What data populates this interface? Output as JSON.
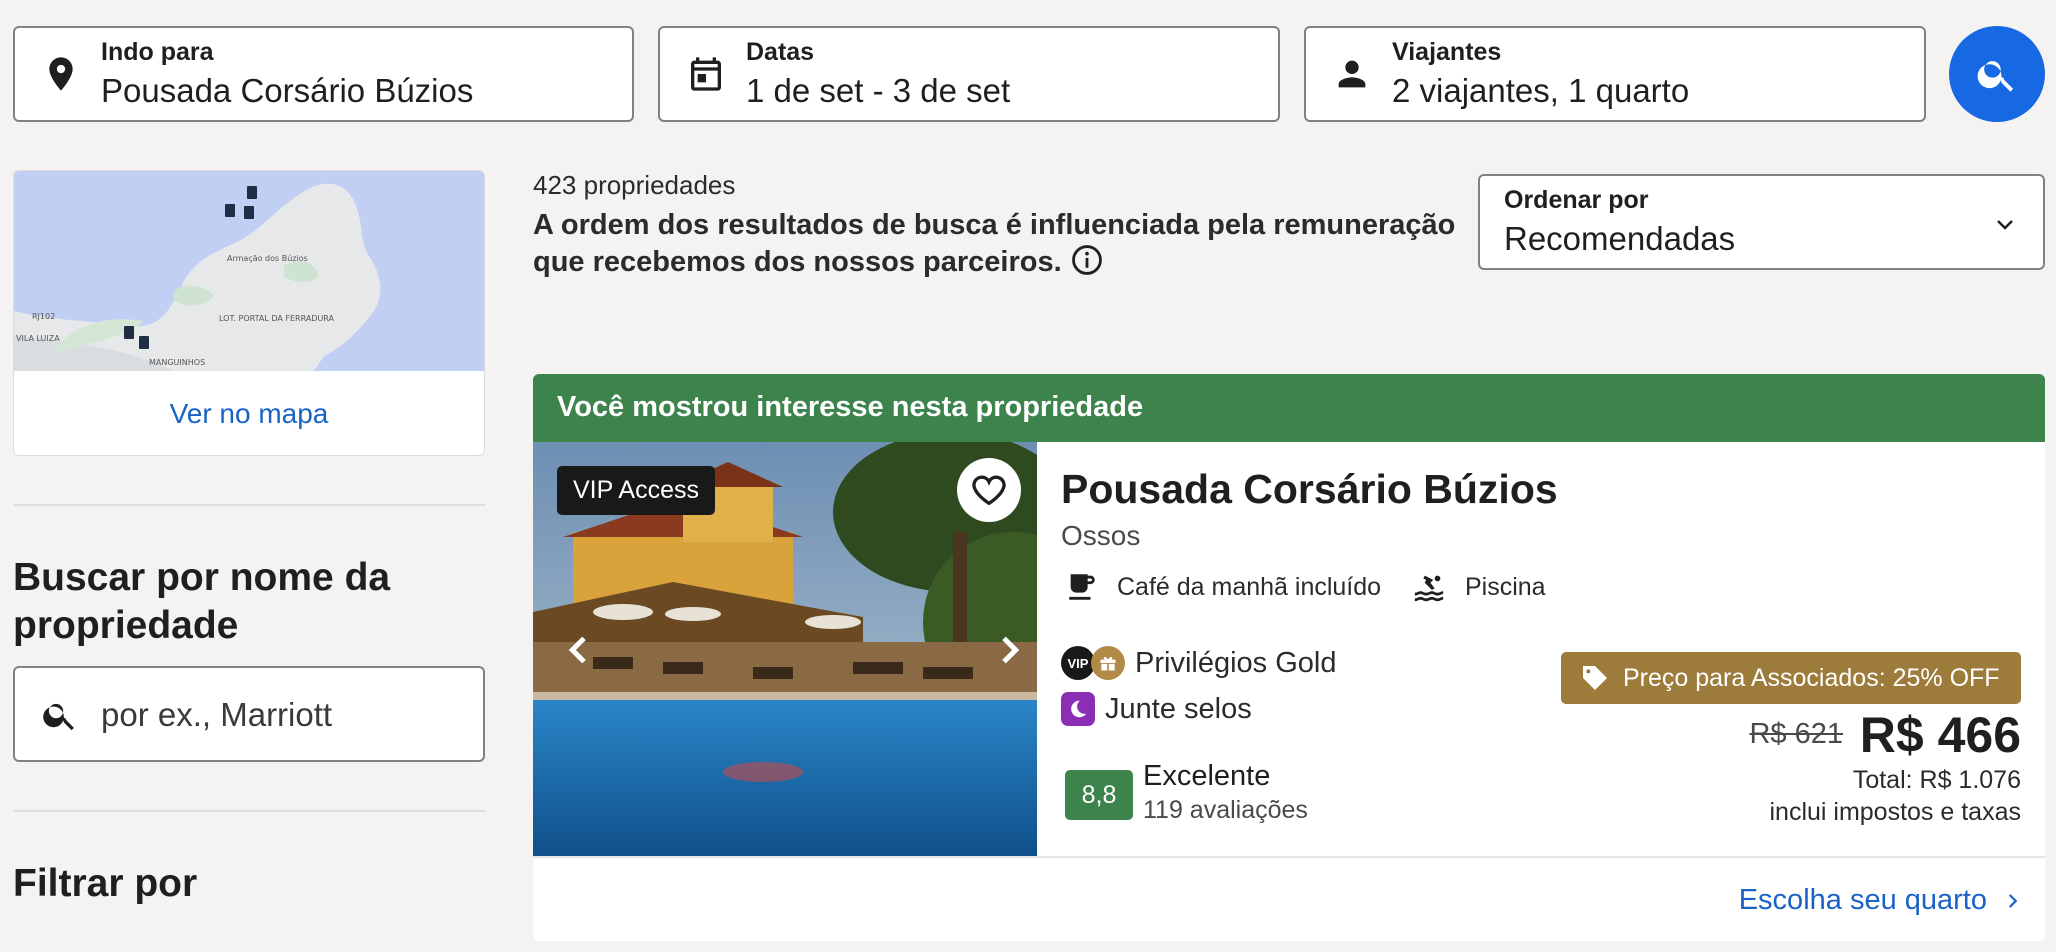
{
  "search": {
    "destination": {
      "label": "Indo para",
      "value": "Pousada Corsário Búzios",
      "icon": "location-pin-icon"
    },
    "dates": {
      "label": "Datas",
      "value": "1 de set - 3 de set",
      "icon": "calendar-icon"
    },
    "travelers": {
      "label": "Viajantes",
      "value": "2 viajantes, 1 quarto",
      "icon": "person-icon"
    },
    "button_icon": "search-icon"
  },
  "sidebar": {
    "map": {
      "labels": [
        "Armação dos Búzios",
        "LOT. PORTAL DA FERRADURA",
        "VILA LUIZA",
        "MANGUINHOS",
        "RJ102"
      ],
      "link": "Ver no mapa"
    },
    "name_search": {
      "title": "Buscar por nome da propriedade",
      "placeholder": "por ex., Marriott"
    },
    "filter_title": "Filtrar por"
  },
  "results": {
    "count": "423 propriedades",
    "disclaimer": "A ordem dos resultados de busca é influenciada pela remuneração que recebemos dos nossos parceiros.",
    "sort": {
      "label": "Ordenar por",
      "value": "Recomendadas"
    }
  },
  "property": {
    "banner": "Você mostrou interesse nesta propriedade",
    "badge": "VIP Access",
    "name": "Pousada Corsário Búzios",
    "area": "Ossos",
    "amenities": [
      "Café da manhã incluído",
      "Piscina"
    ],
    "loyalty": {
      "vip": "VIP",
      "gold": "Privilégios Gold",
      "stamps": "Junte selos"
    },
    "rating": {
      "score": "8,8",
      "label": "Excelente",
      "reviews": "119 avaliações"
    },
    "member_tag": "Preço para Associados: 25% OFF",
    "old_price": "R$ 621",
    "price": "R$ 466",
    "total": "Total: R$ 1.076",
    "taxes": "inclui impostos e taxas",
    "cta": "Escolha seu quarto"
  },
  "colors": {
    "primary": "#1668e3",
    "link": "#1a63c6",
    "banner_green": "#3c834c",
    "member_gold": "#9d7b3a"
  }
}
